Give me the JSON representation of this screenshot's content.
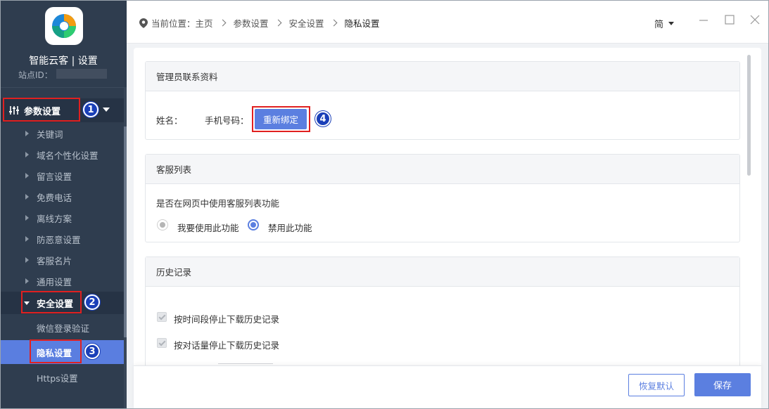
{
  "sidebar": {
    "app_title": "智能云客 | 设置",
    "site_id_label": "站点ID：",
    "group_param": "参数设置",
    "items": [
      "关键词",
      "域名个性化设置",
      "留言设置",
      "免费电话",
      "离线方案",
      "防恶意设置",
      "客服名片",
      "通用设置"
    ],
    "group_security": "安全设置",
    "security_items": [
      "微信登录验证",
      "隐私设置",
      "Https设置"
    ]
  },
  "header": {
    "breadcrumb": [
      "当前位置：主页",
      "参数设置",
      "安全设置",
      "隐私设置"
    ],
    "language": "简"
  },
  "admin_card": {
    "title": "管理员联系资料",
    "name_label": "姓名：",
    "phone_label": "手机号码：",
    "rebind_label": "重新绑定"
  },
  "service_card": {
    "title": "客服列表",
    "question": "是否在网页中使用客服列表功能",
    "option_enable": "我要使用此功能",
    "option_disable": "禁用此功能",
    "selected": "disable"
  },
  "history_card": {
    "title": "历史记录",
    "opt_time": "按时间段停止下载历史记录",
    "opt_count": "按对话量停止下载历史记录"
  },
  "footer": {
    "reset_label": "恢复默认",
    "save_label": "保存"
  },
  "markers": [
    "1",
    "2",
    "3",
    "4"
  ],
  "colors": {
    "sidebar_bg": "#2f3d4f",
    "accent": "#5b7fe0",
    "highlight_box": "#e02020",
    "marker": "#1a3fb8"
  }
}
